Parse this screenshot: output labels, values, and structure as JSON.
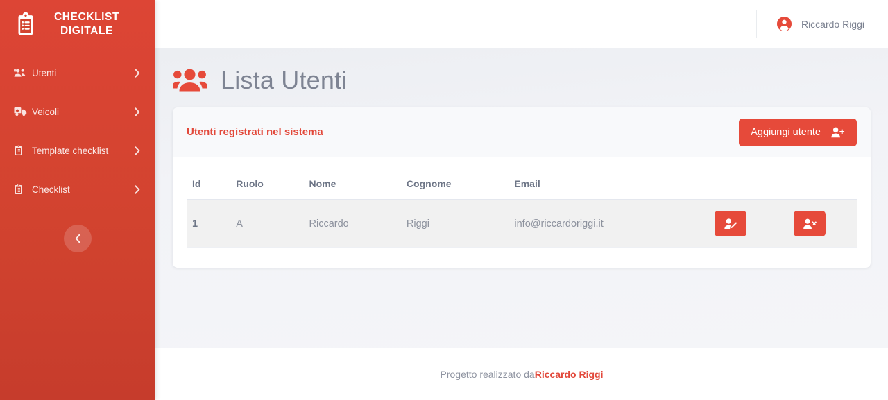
{
  "brand": {
    "line1": "CHECKLIST",
    "line2": "DIGITALE",
    "icon": "clipboard-list-icon"
  },
  "sidebar": {
    "items": [
      {
        "label": "Utenti",
        "icon": "users-icon",
        "caret": "chevron-right-icon"
      },
      {
        "label": "Veicoli",
        "icon": "ambulance-icon",
        "caret": "chevron-right-icon"
      },
      {
        "label": "Template checklist",
        "icon": "clipboard-icon",
        "caret": "chevron-right-icon"
      },
      {
        "label": "Checklist",
        "icon": "clipboard-icon",
        "caret": "chevron-right-icon"
      }
    ],
    "collapse_icon": "chevron-left-icon",
    "accent": "#d2432f"
  },
  "topbar": {
    "user_name": "Riccardo Riggi",
    "user_icon": "user-circle-icon"
  },
  "page": {
    "title": "Lista Utenti",
    "title_icon": "users-icon"
  },
  "card": {
    "title": "Utenti registrati nel sistema",
    "add_button": {
      "label": "Aggiungi utente",
      "icon": "user-plus-icon"
    }
  },
  "table": {
    "columns": [
      "Id",
      "Ruolo",
      "Nome",
      "Cognome",
      "Email",
      ""
    ],
    "rows": [
      {
        "id": "1",
        "ruolo": "A",
        "nome": "Riccardo",
        "cognome": "Riggi",
        "email": "info@riccardoriggi.it",
        "actions": [
          {
            "name": "edit-user-button",
            "icon": "user-edit-icon"
          },
          {
            "name": "delete-user-button",
            "icon": "user-times-icon"
          }
        ]
      }
    ]
  },
  "footer": {
    "prefix": "Progetto realizzato da ",
    "author": "Riccardo Riggi"
  },
  "colors": {
    "brand_red": "#e64a3a",
    "sidebar_red": "#d2432f",
    "text_muted": "#8d929e",
    "heading": "#7e8493"
  }
}
